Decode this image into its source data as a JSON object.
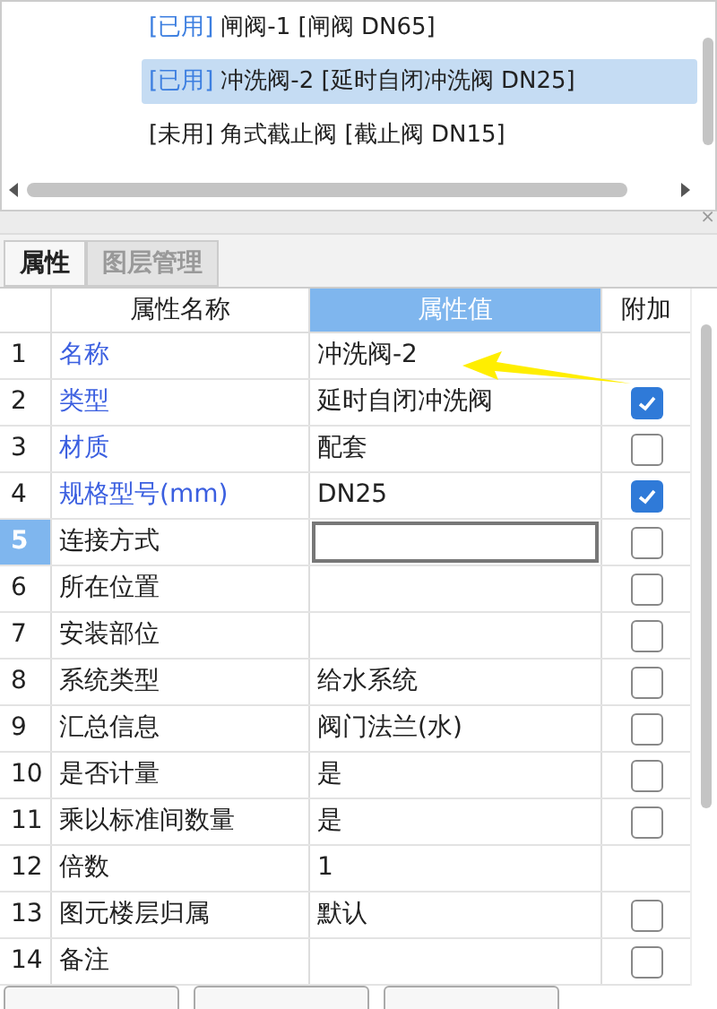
{
  "component_list": [
    {
      "status": "[已用]",
      "used": true,
      "label": "闸阀-1 [闸阀 DN65]",
      "selected": false
    },
    {
      "status": "[已用]",
      "used": true,
      "label": "冲洗阀-2 [延时自闭冲洗阀 DN25]",
      "selected": true
    },
    {
      "status": "[未用]",
      "used": false,
      "label": "角式截止阀 [截止阀 DN15]",
      "selected": false
    }
  ],
  "close_glyph": "×",
  "tabs": [
    {
      "label": "属性",
      "selected": true
    },
    {
      "label": "图层管理",
      "selected": false
    }
  ],
  "table": {
    "columns": [
      "属性名称",
      "属性值",
      "附加"
    ],
    "rows": [
      {
        "index": "1",
        "name": "名称",
        "value": "冲洗阀-2",
        "public": true,
        "selected": false,
        "kind": "plain"
      },
      {
        "index": "2",
        "name": "类型",
        "value": "延时自闭冲洗阀",
        "public": true,
        "selected": false,
        "kind": "check",
        "checked": true
      },
      {
        "index": "3",
        "name": "材质",
        "value": "配套",
        "public": true,
        "selected": false,
        "kind": "check",
        "checked": false
      },
      {
        "index": "4",
        "name": "规格型号(mm)",
        "value": "DN25",
        "public": true,
        "selected": false,
        "kind": "check",
        "checked": true
      },
      {
        "index": "5",
        "name": "连接方式",
        "public": false,
        "selected": true,
        "kind": "check",
        "checked": false
      },
      {
        "index": "6",
        "name": "所在位置",
        "public": false,
        "selected": false,
        "kind": "check",
        "checked": false
      },
      {
        "index": "7",
        "name": "安装部位",
        "public": false,
        "selected": false,
        "kind": "check",
        "checked": false
      },
      {
        "index": "8",
        "name": "系统类型",
        "value": "给水系统",
        "public": false,
        "selected": false,
        "kind": "check",
        "checked": false
      },
      {
        "index": "9",
        "name": "汇总信息",
        "value": "阀门法兰(水)",
        "public": false,
        "selected": false,
        "kind": "check",
        "checked": false
      },
      {
        "index": "10",
        "name": "是否计量",
        "value": "是",
        "public": false,
        "selected": false,
        "kind": "check",
        "checked": false
      },
      {
        "index": "11",
        "name": "乘以标准间数量",
        "value": "是",
        "public": false,
        "selected": false,
        "kind": "check",
        "checked": false
      },
      {
        "index": "12",
        "name": "倍数",
        "value": "1",
        "public": false,
        "selected": false,
        "kind": "plain"
      },
      {
        "index": "13",
        "name": "图元楼层归属",
        "value": "默认",
        "public": false,
        "selected": false,
        "kind": "check",
        "checked": false
      },
      {
        "index": "14",
        "name": "备注",
        "public": false,
        "selected": false,
        "kind": "check",
        "checked": false
      }
    ]
  }
}
